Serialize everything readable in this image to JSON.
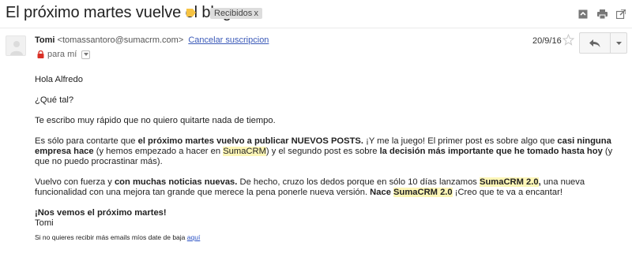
{
  "subject": {
    "title": "El próximo martes vuelve el blog",
    "label_chip": "Recibidos",
    "chip_close": "x"
  },
  "sender": {
    "name": "Tomi",
    "email": "<tomassantoro@sumacrm.com>",
    "unsubscribe": "Cancelar suscripcion",
    "to": "para mí",
    "date": "20/9/16"
  },
  "message": {
    "greeting": "Hola Alfredo",
    "question": "¿Qué tal?",
    "intro": "Te escribo muy rápido que no quiero quitarte nada de tiempo.",
    "p4": {
      "t1": "Es sólo para contarte que ",
      "b1": "el próximo martes vuelvo a publicar NUEVOS POSTS.",
      "t2": " ¡Y me la juego! El primer post es sobre algo que ",
      "b2": "casi ninguna empresa hace",
      "t3": " (y hemos empezado a hacer en ",
      "h1": "SumaCRM",
      "t4": ") y el segundo post es sobre ",
      "b3": "la decisión más importante que he tomado hasta hoy",
      "t5": " (y que no puedo procrastinar más)."
    },
    "p5": {
      "t1": "Vuelvo con fuerza y ",
      "b1": "con muchas noticias nuevas.",
      "t2": " De hecho, cruzo los dedos porque en sólo 10 días lanzamos ",
      "h1": "SumaCRM 2.0",
      "b2": ",",
      "t3": " una nueva funcionalidad con una mejora tan grande que merece la pena ponerle nueva versión. ",
      "b3": "Nace ",
      "h2": "SumaCRM 2.0",
      "t4": " ¡Creo que te va a encantar!"
    },
    "signoff": "¡Nos vemos el próximo martes!",
    "signature": "Tomi"
  },
  "footer": {
    "text": "Si no quieres recibir más emails míos date de baja ",
    "link": "aquí"
  },
  "icons": {
    "label_color": "#f6c343",
    "lock_color": "#d93025"
  }
}
